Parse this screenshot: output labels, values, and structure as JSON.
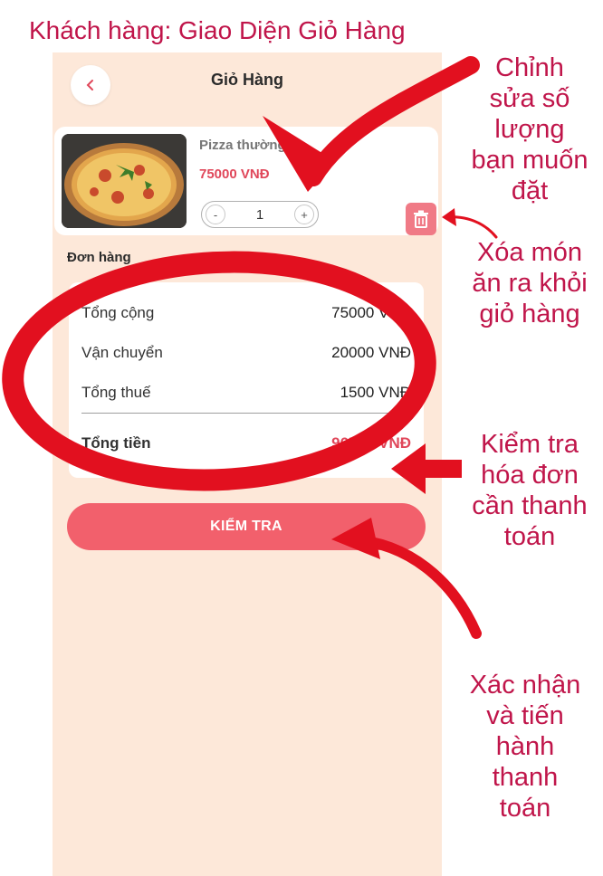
{
  "page_title": "Khách hàng: Giao Diện Giỏ Hàng",
  "header": {
    "title": "Giỏ Hàng",
    "back_icon": "chevron-left-icon"
  },
  "item": {
    "name": "Pizza thường",
    "price": "75000 VNĐ",
    "qty_minus": "-",
    "quantity": "1",
    "qty_plus": "+",
    "delete_icon": "trash-icon"
  },
  "summary": {
    "title": "Đơn hàng",
    "rows": [
      {
        "label": "Tổng cộng",
        "value": "75000 VNĐ"
      },
      {
        "label": "Vận chuyển",
        "value": "20000 VNĐ"
      },
      {
        "label": "Tổng thuế",
        "value": "1500 VNĐ"
      }
    ],
    "total_label": "Tổng tiền",
    "total_value": "96500 VNĐ"
  },
  "checkout_label": "KIỂM TRA",
  "annotations": {
    "edit_quantity": [
      "Chỉnh",
      "sửa số",
      "lượng",
      "bạn muốn",
      "đặt"
    ],
    "delete_item": [
      "Xóa món",
      "ăn ra khỏi",
      "giỏ hàng"
    ],
    "check_invoice": [
      "Kiểm tra",
      "hóa đơn",
      "cần thanh",
      "toán"
    ],
    "confirm_payment": [
      "Xác nhận",
      "và tiến",
      "hành",
      "thanh",
      "toán"
    ]
  },
  "colors": {
    "annotation_red": "#c0154a",
    "marker_red": "#e2101f",
    "screen_bg": "#fde8d9",
    "button_bg": "#f2606c",
    "price_red": "#e0475a"
  }
}
